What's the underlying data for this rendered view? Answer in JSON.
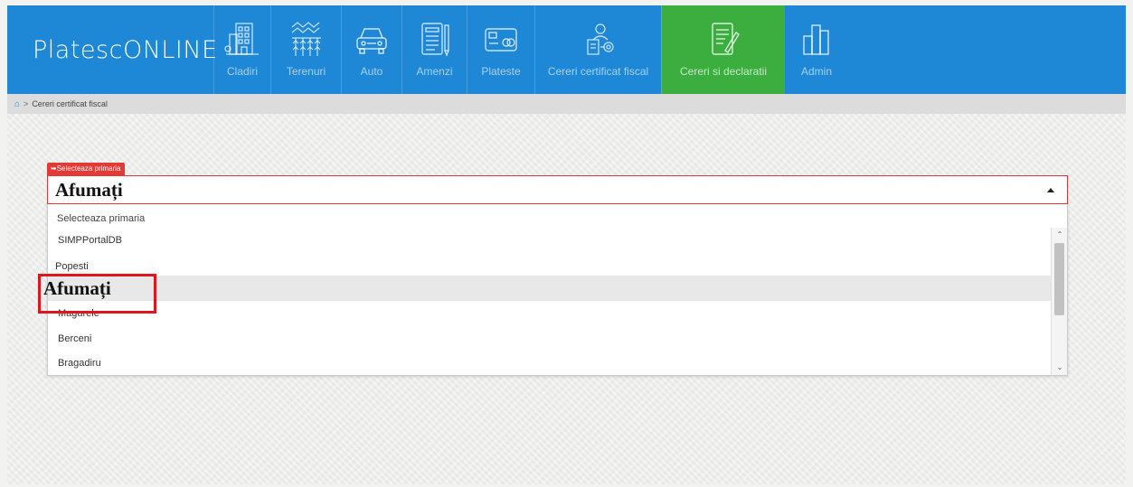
{
  "app": {
    "brand": "PlatescONLINE"
  },
  "nav": {
    "items": [
      {
        "label": "Cladiri",
        "icon": "building-icon"
      },
      {
        "label": "Terenuri",
        "icon": "field-icon"
      },
      {
        "label": "Auto",
        "icon": "car-icon"
      },
      {
        "label": "Amenzi",
        "icon": "document-fine-icon"
      },
      {
        "label": "Plateste",
        "icon": "card-payment-icon"
      },
      {
        "label": "Cereri certificat fiscal",
        "icon": "certificate-request-icon"
      },
      {
        "label": "Cereri si declaratii",
        "icon": "form-declaration-icon",
        "active": true
      },
      {
        "label": "Admin",
        "icon": "bar-chart-icon"
      }
    ]
  },
  "breadcrumb": {
    "home_icon": "home-icon",
    "separator": ">",
    "current": "Cereri certificat fiscal"
  },
  "select": {
    "label": "Selecteaza primaria",
    "value": "Afumați",
    "dropdown_header": "Selecteaza primaria",
    "options": [
      "SIMPPortalDB",
      "Popesti",
      "Afumați",
      "Magurele",
      "Berceni",
      "Bragadiru"
    ],
    "selected_index": 2
  },
  "colors": {
    "navbar": "#1e88d6",
    "active_nav": "#3cae3f",
    "accent_red": "#e53935",
    "highlight_red": "#e0161e"
  }
}
